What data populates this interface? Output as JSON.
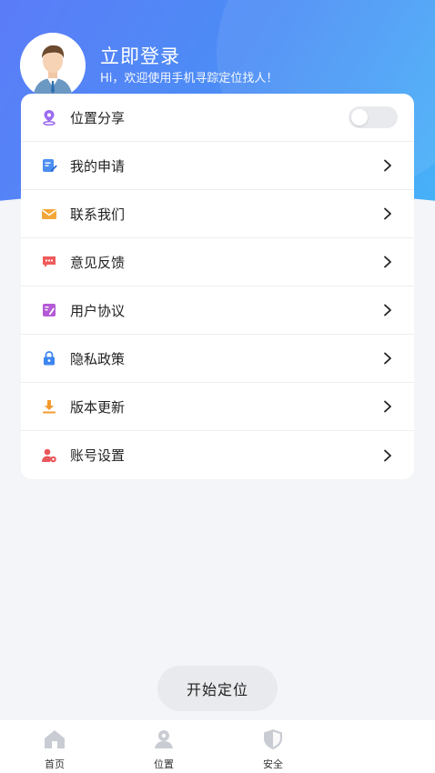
{
  "profile": {
    "login_label": "立即登录",
    "greeting": "Hi，欢迎使用手机寻踪定位找人！"
  },
  "menu": {
    "items": [
      {
        "label": "位置分享",
        "icon": "location-share-icon",
        "type": "toggle",
        "toggle_on": false
      },
      {
        "label": "我的申请",
        "icon": "application-icon",
        "type": "link"
      },
      {
        "label": "联系我们",
        "icon": "mail-icon",
        "type": "link"
      },
      {
        "label": "意见反馈",
        "icon": "feedback-icon",
        "type": "link"
      },
      {
        "label": "用户协议",
        "icon": "agreement-icon",
        "type": "link"
      },
      {
        "label": "隐私政策",
        "icon": "lock-icon",
        "type": "link"
      },
      {
        "label": "版本更新",
        "icon": "download-icon",
        "type": "link"
      },
      {
        "label": "账号设置",
        "icon": "user-settings-icon",
        "type": "link"
      }
    ]
  },
  "start_button": "开始定位",
  "tabbar": {
    "tabs": [
      {
        "label": "首页",
        "icon": "home-icon"
      },
      {
        "label": "位置",
        "icon": "location-person-icon"
      },
      {
        "label": "安全",
        "icon": "shield-icon"
      }
    ]
  },
  "colors": {
    "header_gradient_start": "#5b7cf7",
    "header_gradient_end": "#47b2f8",
    "background": "#f4f5f8",
    "tab_icon": "#c9ccd3"
  }
}
